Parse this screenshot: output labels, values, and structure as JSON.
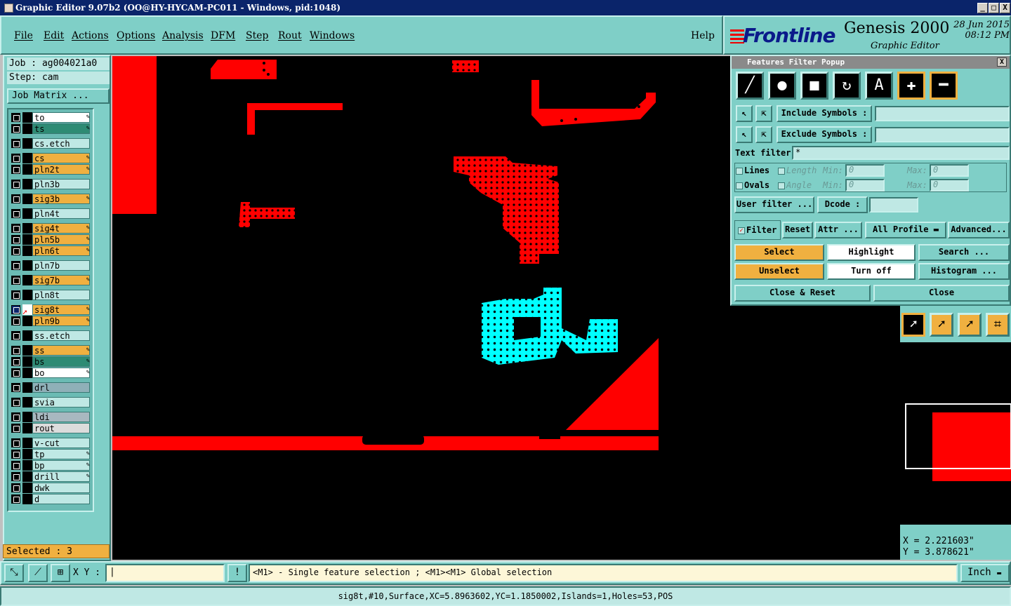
{
  "window": {
    "title": "Graphic Editor 9.07b2 (OO@HY-HYCAM-PC011 - Windows, pid:1048)",
    "minimize": "_",
    "maximize": "□",
    "close": "X"
  },
  "menu": [
    "File",
    "Edit",
    "Actions",
    "Options",
    "Analysis",
    "DFM",
    "Step",
    "Rout",
    "Windows"
  ],
  "help": "Help",
  "brand": {
    "logo": "Frontline",
    "product": "Genesis 2000",
    "subtitle": "Graphic Editor",
    "date": "28 Jun 2015",
    "time": "08:12 PM"
  },
  "job": {
    "job_label": "Job : ag004021a0",
    "step_label": "Step: cam",
    "matrix_button": "Job Matrix ..."
  },
  "layers": [
    {
      "name": "to",
      "color": "#ffffff",
      "pen": true
    },
    {
      "name": "ts",
      "color": "#2e8b74",
      "pen": true
    },
    {
      "name": "cs.etch",
      "color": "#bfe8e4",
      "pen": false
    },
    {
      "name": "cs",
      "color": "#f0b040",
      "pen": true
    },
    {
      "name": "pln2t",
      "color": "#f0b040",
      "pen": true
    },
    {
      "name": "pln3b",
      "color": "#bfe8e4",
      "pen": false
    },
    {
      "name": "sig3b",
      "color": "#f0b040",
      "pen": true
    },
    {
      "name": "pln4t",
      "color": "#bfe8e4",
      "pen": false
    },
    {
      "name": "sig4t",
      "color": "#f0b040",
      "pen": true
    },
    {
      "name": "pln5b",
      "color": "#f0b040",
      "pen": true
    },
    {
      "name": "pln6t",
      "color": "#f0b040",
      "pen": true
    },
    {
      "name": "pln7b",
      "color": "#bfe8e4",
      "pen": false
    },
    {
      "name": "sig7b",
      "color": "#f0b040",
      "pen": true
    },
    {
      "name": "pln8t",
      "color": "#bfe8e4",
      "pen": false
    },
    {
      "name": "sig8t",
      "color": "#f0b040",
      "pen": true,
      "active": true
    },
    {
      "name": "pln9b",
      "color": "#f0b040",
      "pen": true
    },
    {
      "name": "ss.etch",
      "color": "#bfe8e4",
      "pen": false
    },
    {
      "name": "ss",
      "color": "#f0b040",
      "pen": true
    },
    {
      "name": "bs",
      "color": "#2e8b74",
      "pen": true
    },
    {
      "name": "bo",
      "color": "#ffffff",
      "pen": true
    },
    {
      "name": "drl",
      "color": "#8fb0b8",
      "pen": false
    },
    {
      "name": "svia",
      "color": "#bfe8e4",
      "pen": false
    },
    {
      "name": "ldi",
      "color": "#a8b8c0",
      "pen": false
    },
    {
      "name": "rout",
      "color": "#dcdcdc",
      "pen": false
    },
    {
      "name": "v-cut",
      "color": "#bfe8e4",
      "pen": false
    },
    {
      "name": "tp",
      "color": "#bfe8e4",
      "pen": true
    },
    {
      "name": "bp",
      "color": "#bfe8e4",
      "pen": true
    },
    {
      "name": "drill",
      "color": "#bfe8e4",
      "pen": true
    },
    {
      "name": "dwk",
      "color": "#bfe8e4",
      "pen": false
    },
    {
      "name": "d",
      "color": "#bfe8e4",
      "pen": false
    }
  ],
  "selected": "Selected : 3",
  "popup": {
    "title": "Features Filter Popup",
    "include_symbols": "Include Symbols :",
    "exclude_symbols": "Exclude Symbols :",
    "text_filter_label": "Text filter",
    "text_filter_value": "*",
    "lines": "Lines",
    "ovals": "Ovals",
    "length": "Length",
    "angle": "Angle",
    "min": "Min:",
    "max": "Max:",
    "zero": "0",
    "user_filter": "User filter ...",
    "dcode": "Dcode :",
    "filter": "Filter",
    "reset": "Reset",
    "attr": "Attr ...",
    "all_profile": "All Profile",
    "advanced": "Advanced...",
    "select": "Select",
    "highlight": "Highlight",
    "search": "Search ...",
    "unselect": "Unselect",
    "turn_off": "Turn off",
    "histogram": "Histogram ...",
    "close_reset": "Close & Reset",
    "close": "Close"
  },
  "coords": {
    "x": "X = 2.221603\"",
    "y": "Y = 3.878621\""
  },
  "bottom": {
    "xy_label": "X Y :",
    "message": "<M1> - Single feature selection ; <M1><M1> Global selection",
    "unit": "Inch"
  },
  "status": "sig8t,#10,Surface,XC=5.8963602,YC=1.1850002,Islands=1,Holes=53,POS"
}
